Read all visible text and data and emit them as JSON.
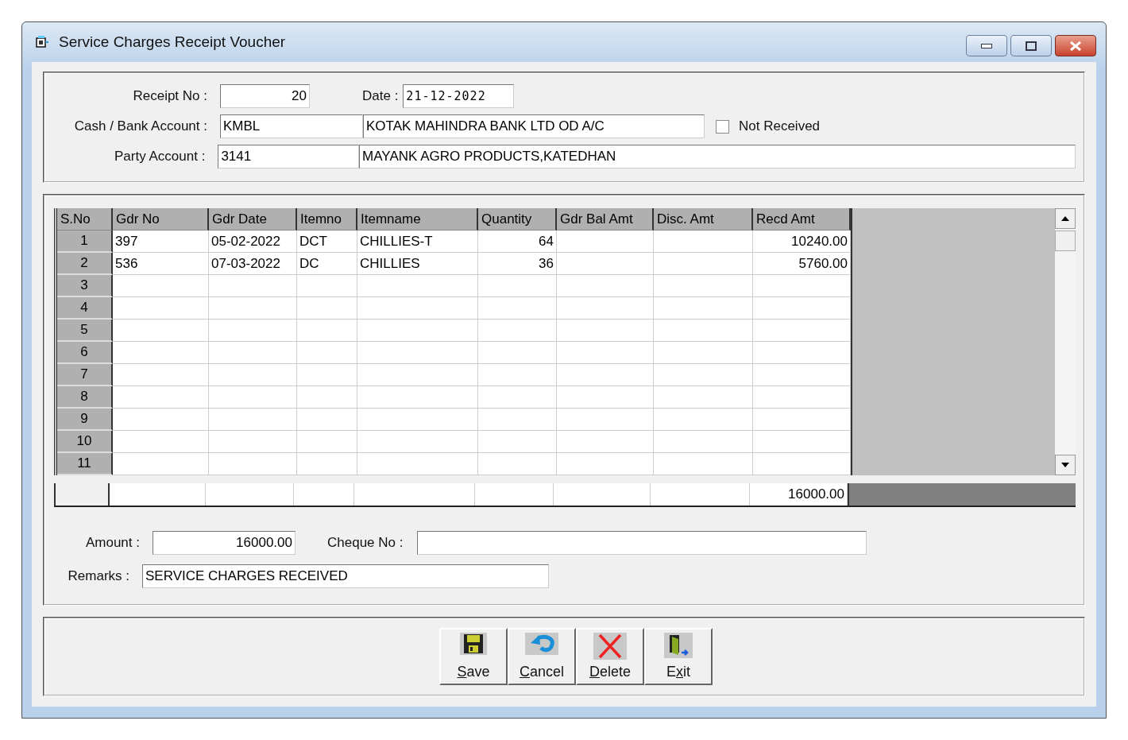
{
  "window": {
    "title": "Service Charges Receipt Voucher"
  },
  "header": {
    "receipt_no_label": "Receipt No  :",
    "receipt_no": "20",
    "date_label": "Date :",
    "date": "21-12-2022",
    "cash_bank_label": "Cash / Bank Account  :",
    "cash_bank_code": "KMBL",
    "cash_bank_name": "KOTAK MAHINDRA BANK LTD OD A/C",
    "not_received": {
      "label": "Not Received",
      "checked": false
    },
    "party_label": "Party Account  :",
    "party_code": "3141",
    "party_name": "MAYANK AGRO PRODUCTS,KATEDHAN"
  },
  "grid": {
    "columns": [
      "S.No",
      "Gdr No",
      "Gdr Date",
      "Itemno",
      "Itemname",
      "Quantity",
      "Gdr Bal Amt",
      "Disc. Amt",
      "Recd Amt"
    ],
    "rows": [
      {
        "sno": "1",
        "gdr_no": "397",
        "gdr_date": "05-02-2022",
        "itemno": "DCT",
        "itemname": "CHILLIES-T",
        "quantity": "64",
        "recd_amt": "10240.00"
      },
      {
        "sno": "2",
        "gdr_no": "536",
        "gdr_date": "07-03-2022",
        "itemno": "DC",
        "itemname": "CHILLIES",
        "quantity": "36",
        "recd_amt": "5760.00"
      },
      {
        "sno": "3"
      },
      {
        "sno": "4"
      },
      {
        "sno": "5"
      },
      {
        "sno": "6"
      },
      {
        "sno": "7"
      },
      {
        "sno": "8"
      },
      {
        "sno": "9"
      },
      {
        "sno": "10"
      },
      {
        "sno": "11"
      }
    ],
    "totals": {
      "recd_amt": "16000.00"
    }
  },
  "footer": {
    "amount_label": "Amount  :",
    "amount": "16000.00",
    "cheque_label": "Cheque No  :",
    "remarks_label": "Remarks  :",
    "remarks": "SERVICE CHARGES RECEIVED"
  },
  "buttons": [
    {
      "kind": "save",
      "label": "Save"
    },
    {
      "kind": "cancel",
      "label": "Cancel"
    },
    {
      "kind": "delete",
      "label": "Delete"
    },
    {
      "kind": "exit",
      "label": "Exit"
    }
  ]
}
